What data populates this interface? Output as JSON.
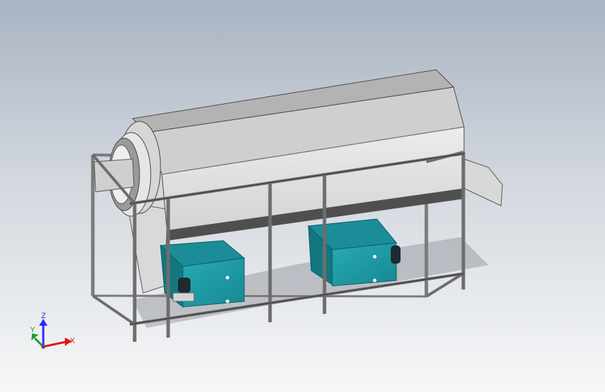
{
  "triad": {
    "z_label": "Z",
    "y_label": "Y",
    "x_label": "X",
    "z_color": "#2a2aff",
    "y_color": "#1f9a2a",
    "x_color": "#e01818"
  },
  "colors": {
    "drum_top": "#bcbcbc",
    "drum_side": "#e2e2e2",
    "drum_dark": "#505050",
    "tank": "#1e9aa6",
    "tank_dark": "#137480",
    "frame": "#6d6d6d",
    "pump": "#1f2a30"
  }
}
